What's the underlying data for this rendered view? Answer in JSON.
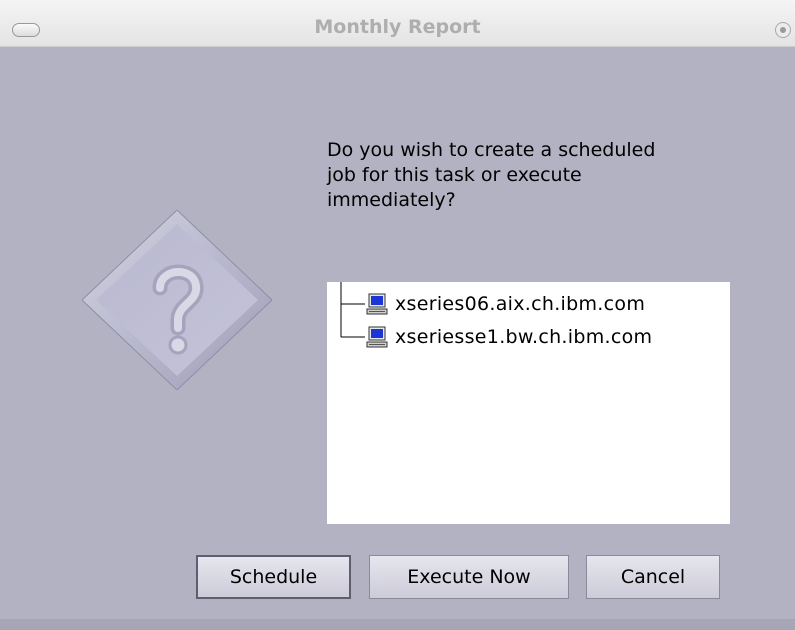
{
  "window": {
    "title": "Monthly Report"
  },
  "dialog": {
    "message": "Do you wish to create a scheduled\njob for this task or execute\nimmediately?",
    "icon": "question-icon",
    "hosts": [
      {
        "label": "xseries06.aix.ch.ibm.com",
        "icon": "computer-icon"
      },
      {
        "label": "xseriesse1.bw.ch.ibm.com",
        "icon": "computer-icon"
      }
    ]
  },
  "buttons": {
    "schedule": "Schedule",
    "execute_now": "Execute Now",
    "cancel": "Cancel"
  },
  "colors": {
    "background": "#b3b2c2",
    "panel": "#ffffff",
    "title_text": "#aeaeae"
  }
}
